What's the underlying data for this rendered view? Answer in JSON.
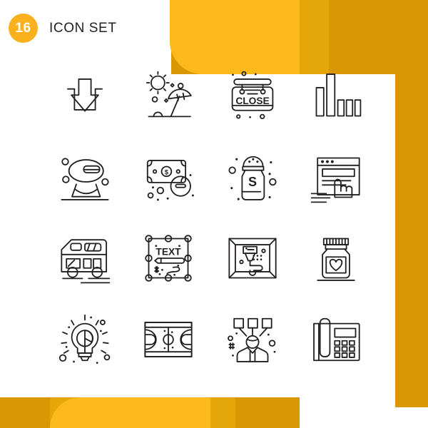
{
  "header": {
    "count": "16",
    "title": "ICON SET"
  },
  "theme": {
    "accent_bright": "#fbb91c",
    "accent_mid": "#e5a609",
    "accent_dark": "#d99704",
    "badge": "#f9b21d",
    "stroke": "#231f20",
    "background": "#ffffff"
  },
  "grid": {
    "columns": 4,
    "rows": 4,
    "icons": [
      {
        "index": 1,
        "name": "download-icon",
        "label": "Download"
      },
      {
        "index": 2,
        "name": "beach-umbrella-icon",
        "label": "Beach"
      },
      {
        "index": 3,
        "name": "close-sign-icon",
        "label": "Close Sign",
        "text": "CLOSE"
      },
      {
        "index": 4,
        "name": "bar-chart-icon",
        "label": "Bar Chart"
      },
      {
        "index": 5,
        "name": "computer-mouse-icon",
        "label": "Mouse"
      },
      {
        "index": 6,
        "name": "money-minus-icon",
        "label": "Money Minus",
        "text": "$"
      },
      {
        "index": 7,
        "name": "salt-shaker-icon",
        "label": "Salt Shaker",
        "text": "S"
      },
      {
        "index": 8,
        "name": "browser-click-icon",
        "label": "Browser Click"
      },
      {
        "index": 9,
        "name": "bus-van-icon",
        "label": "Bus"
      },
      {
        "index": 10,
        "name": "text-edit-icon",
        "label": "Text Edit",
        "text": "TEXT"
      },
      {
        "index": 11,
        "name": "engraving-machine-icon",
        "label": "Engraving Machine"
      },
      {
        "index": 12,
        "name": "heart-jar-icon",
        "label": "Heart Jar"
      },
      {
        "index": 13,
        "name": "idea-chart-bulb-icon",
        "label": "Idea Chart Bulb"
      },
      {
        "index": 14,
        "name": "basketball-court-icon",
        "label": "Basketball Court"
      },
      {
        "index": 15,
        "name": "person-skills-icon",
        "label": "Person Skills"
      },
      {
        "index": 16,
        "name": "office-phone-icon",
        "label": "Office Phone"
      }
    ]
  }
}
